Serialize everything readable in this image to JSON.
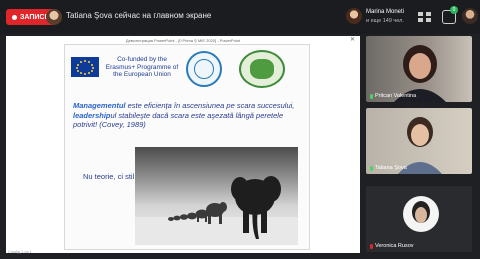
{
  "topbar": {
    "record_label": "ЗАПИСЬ",
    "presenter_text": "Tatiana Şova сейчас на главном экране",
    "host_name": "Marina Moneti",
    "host_sub": "и еще 149 чел.",
    "chat_badge": "0",
    "record_color": "#e0262a"
  },
  "presentation": {
    "window_title": "Демонстрация PowerPoint - [0 Prima Ş MIE 2020] - PowerPoint",
    "slide": {
      "funding_text": "Co-funded by the Erasmus+ Programme of the European Union",
      "quote_manage_word": "Managementul",
      "quote_manage_rest": " este eficienţa  în ascensiunea pe scara succesului,",
      "quote_lead_word": "leadership",
      "quote_lead_rest": "ul stabileşte dacă scara este aşezată lângă peretele potrivit! (Covey, 1989)",
      "subtitle": "Nu teorie, ci stil..."
    }
  },
  "participants": [
    {
      "name": "Pritcan Valentina"
    },
    {
      "name": "Tatiana Şova"
    },
    {
      "name": "Veronica Rusov"
    }
  ],
  "bottom_text": "Слайд 1 из 1"
}
